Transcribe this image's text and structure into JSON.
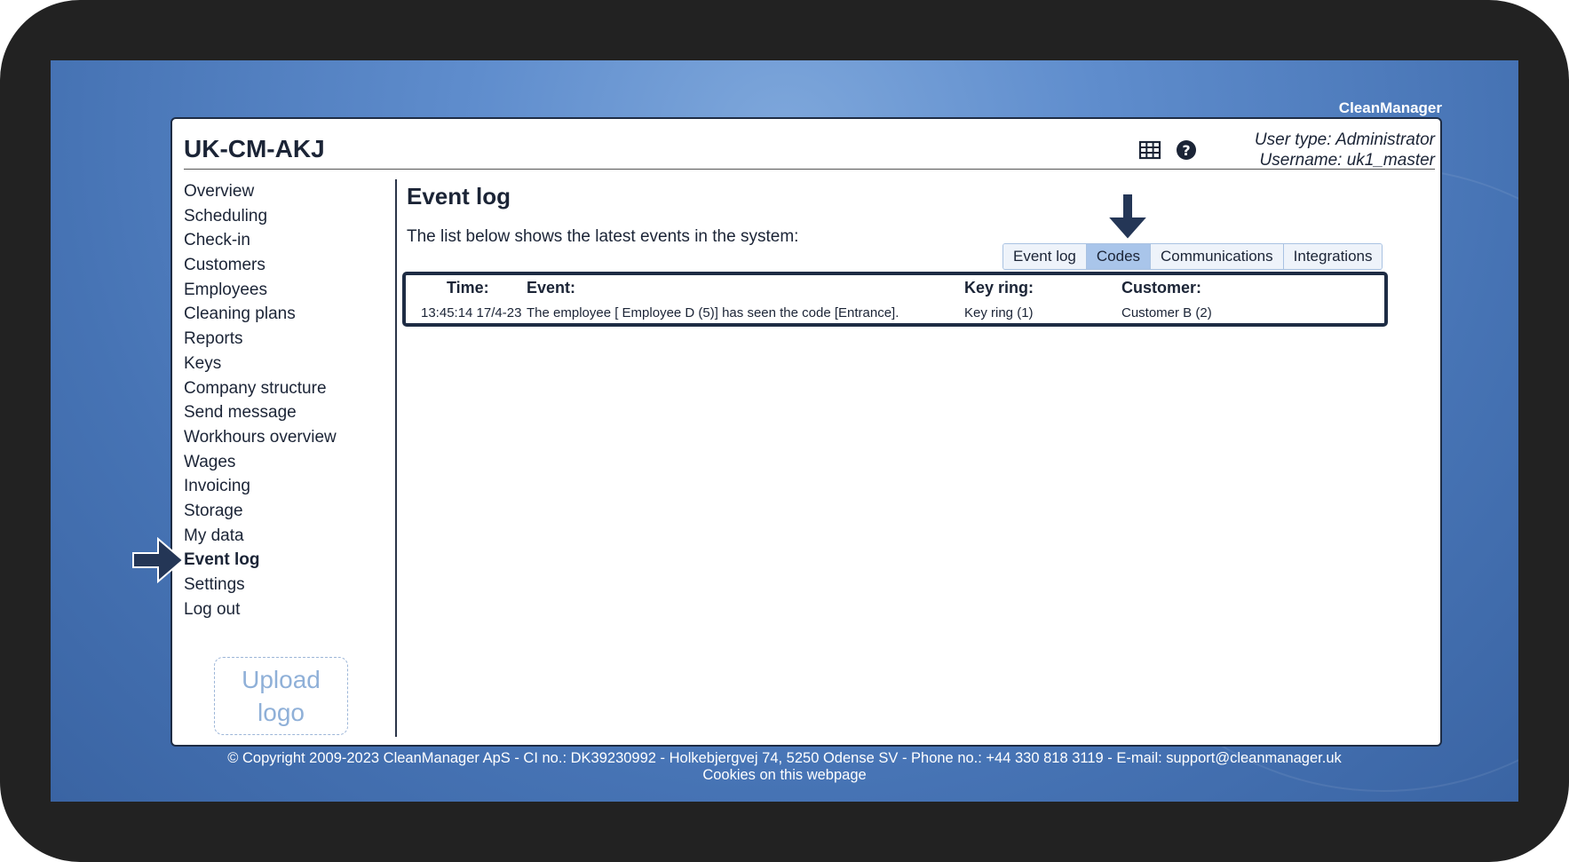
{
  "brand": "CleanManager",
  "app_title": "UK-CM-AKJ",
  "user": {
    "type_line": "User type: Administrator",
    "username_line": "Username: uk1_master"
  },
  "header_icons": [
    "table-icon",
    "help-icon"
  ],
  "nav": [
    {
      "label": "Overview"
    },
    {
      "label": "Scheduling"
    },
    {
      "label": "Check-in"
    },
    {
      "label": "Customers"
    },
    {
      "label": "Employees"
    },
    {
      "label": "Cleaning plans"
    },
    {
      "label": "Reports"
    },
    {
      "label": "Keys"
    },
    {
      "label": "Company structure"
    },
    {
      "label": "Send message"
    },
    {
      "label": "Workhours overview"
    },
    {
      "label": "Wages"
    },
    {
      "label": "Invoicing"
    },
    {
      "label": "Storage"
    },
    {
      "label": "My data"
    },
    {
      "label": "Event log",
      "active": true
    },
    {
      "label": "Settings"
    },
    {
      "label": "Log out"
    }
  ],
  "upload_logo": {
    "line1": "Upload",
    "line2": "logo"
  },
  "main": {
    "title": "Event log",
    "intro": "The list below shows the latest events in the system:",
    "tabs": [
      {
        "label": "Event log"
      },
      {
        "label": "Codes",
        "active": true
      },
      {
        "label": "Communications"
      },
      {
        "label": "Integrations"
      }
    ],
    "table": {
      "headers": {
        "time": "Time:",
        "event": "Event:",
        "key_ring": "Key ring:",
        "customer": "Customer:"
      },
      "rows": [
        {
          "time": "13:45:14 17/4-23",
          "event": "The employee [ Employee D (5)] has seen the code [Entrance].",
          "key_ring": "Key ring (1)",
          "customer": "Customer B (2)"
        }
      ]
    }
  },
  "footer": {
    "copyright": "© Copyright 2009-2023 CleanManager ApS - CI no.: DK39230992 - Holkebjergvej 74, 5250 Odense SV - Phone no.: +44 330 818 3119 - E-mail: support@cleanmanager.uk",
    "cookies": "Cookies on this webpage"
  },
  "colors": {
    "accent": "#a9c5ea",
    "dark": "#1e2c44",
    "background": "#4f7fc2"
  }
}
